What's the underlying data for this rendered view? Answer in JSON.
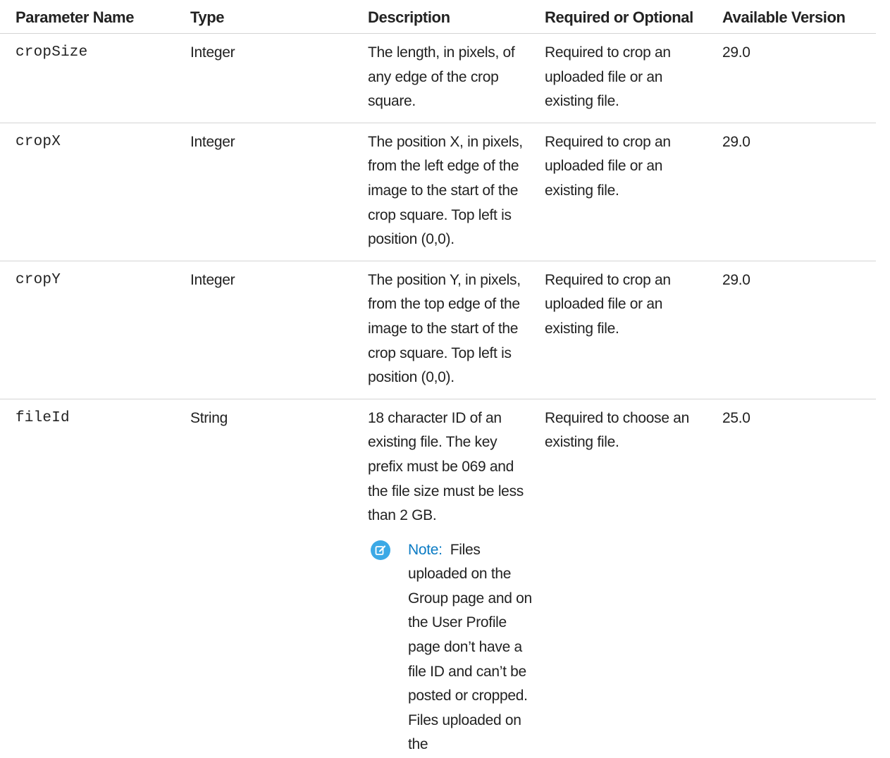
{
  "table": {
    "headers": [
      "Parameter Name",
      "Type",
      "Description",
      "Required or Optional",
      "Available Version"
    ],
    "rows": [
      {
        "name": "cropSize",
        "type": "Integer",
        "description": "The length, in pixels, of any edge of the crop square.",
        "required": "Required to crop an uploaded file or an existing file.",
        "version": "29.0"
      },
      {
        "name": "cropX",
        "type": "Integer",
        "description": "The position X, in pixels, from the left edge of the image to the start of the crop square. Top left is position (0,0).",
        "required": "Required to crop an uploaded file or an existing file.",
        "version": "29.0"
      },
      {
        "name": "cropY",
        "type": "Integer",
        "description": "The position Y, in pixels, from the top edge of the image to the start of the crop square. Top left is position (0,0).",
        "required": "Required to crop an uploaded file or an existing file.",
        "version": "29.0"
      },
      {
        "name": "fileId",
        "type": "String",
        "description": "18 character ID of an existing file. The key prefix must be 069 and the file size must be less than 2 GB.",
        "required": "Required to choose an existing file.",
        "version": "25.0",
        "note_label": "Note:",
        "note_text": "Files uploaded on the Group page and on the User Profile page don’t have a file ID and can’t be posted or cropped. Files uploaded on the"
      }
    ]
  },
  "colors": {
    "note_icon": "#3ba9e6",
    "note_label": "#0a7bc4",
    "divider": "#d4d4d4"
  },
  "icons": {
    "note": "edit-note-icon"
  }
}
